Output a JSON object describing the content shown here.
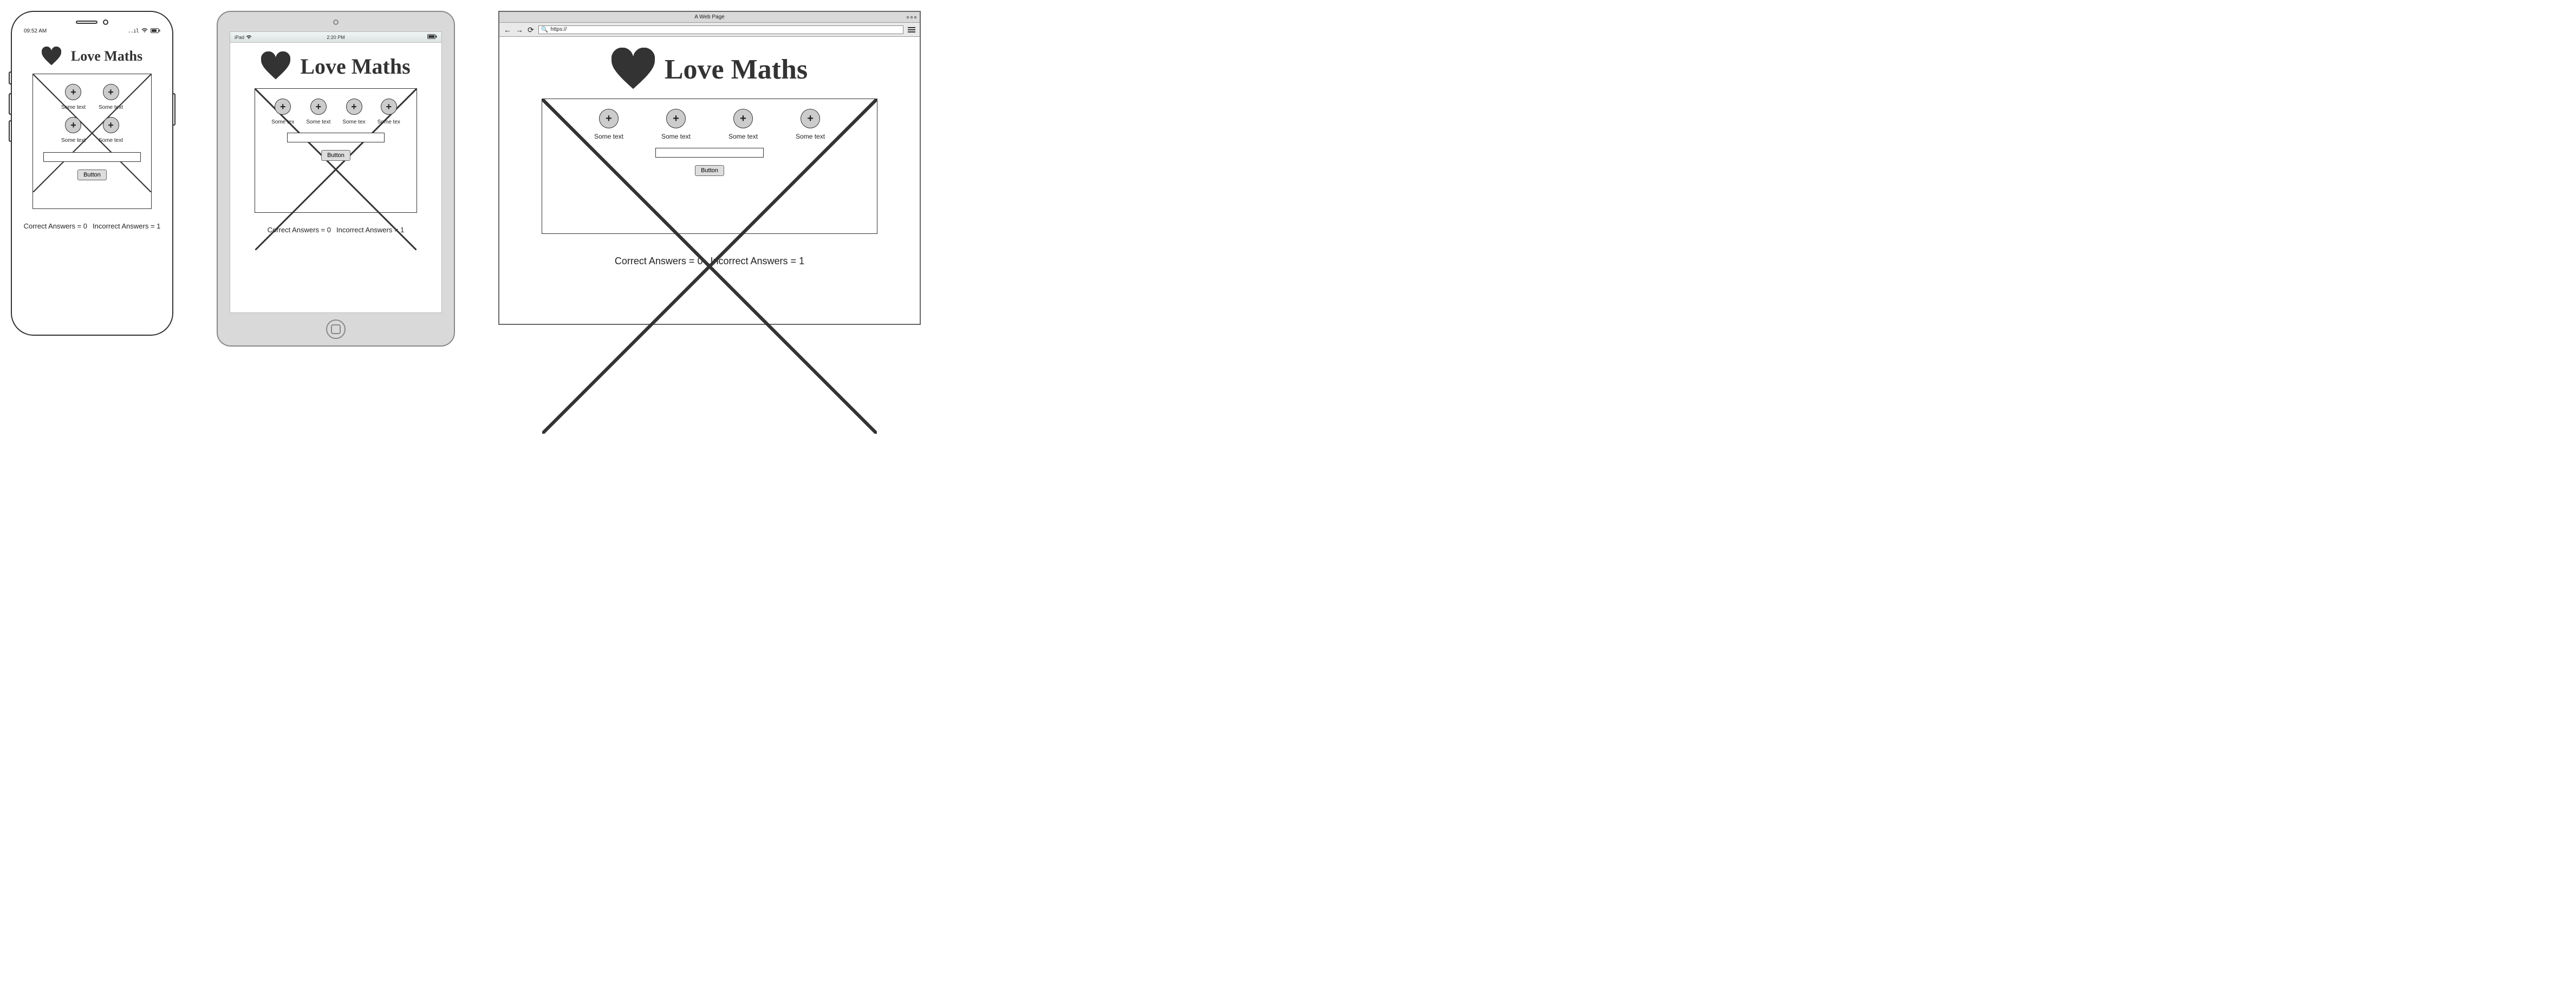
{
  "app": {
    "title": "Love Maths",
    "submit_label": "Button",
    "score": {
      "correct_label": "Correct Answers =",
      "correct_value": "0",
      "incorrect_label": "Incorrect Answers =",
      "incorrect_value": "1"
    }
  },
  "phone": {
    "time": "09:52 AM",
    "signal": "..ıl",
    "wifi_icon": "wifi",
    "battery_icon": "battery",
    "ops": [
      {
        "icon": "+",
        "label": "Some text"
      },
      {
        "icon": "+",
        "label": "Some text"
      },
      {
        "icon": "+",
        "label": "Some text"
      },
      {
        "icon": "+",
        "label": "Some text"
      }
    ]
  },
  "tablet": {
    "device_label": "iPad",
    "time": "2:20 PM",
    "ops": [
      {
        "icon": "+",
        "label": "Some tex"
      },
      {
        "icon": "+",
        "label": "Some text"
      },
      {
        "icon": "+",
        "label": "Some tex"
      },
      {
        "icon": "+",
        "label": "Some tex"
      }
    ]
  },
  "browser": {
    "window_title": "A Web Page",
    "url_value": "https://",
    "ops": [
      {
        "icon": "+",
        "label": "Some text"
      },
      {
        "icon": "+",
        "label": "Some text"
      },
      {
        "icon": "+",
        "label": "Some text"
      },
      {
        "icon": "+",
        "label": "Some text"
      }
    ]
  }
}
